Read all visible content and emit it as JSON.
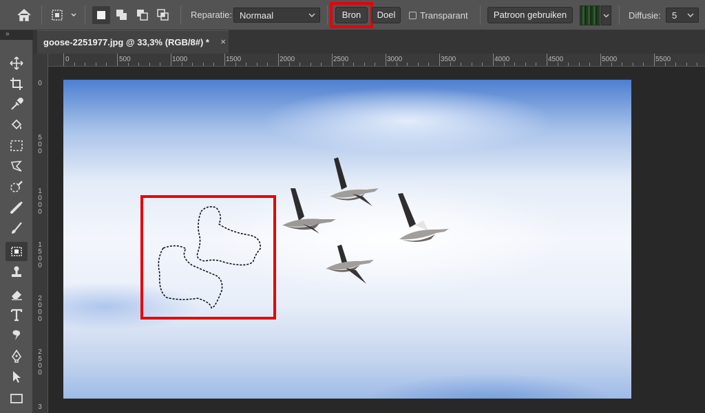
{
  "options_bar": {
    "icons": [
      "home-icon",
      "patch-tool-preset-icon",
      "selection-mode-new-icon",
      "selection-mode-add-icon",
      "selection-mode-subtract-icon",
      "selection-mode-intersect-icon"
    ],
    "repair_label": "Reparatie:",
    "repair_value": "Normaal",
    "source_label": "Bron",
    "destination_label": "Doel",
    "transparent_label": "Transparant",
    "transparent_checked": false,
    "use_pattern_label": "Patroon gebruiken",
    "diffusion_label": "Diffusie:",
    "diffusion_value": "5",
    "highlight_color": "#e8000a"
  },
  "document": {
    "collapse_label": "»",
    "tab_title": "goose-2251977.jpg @ 33,3% (RGB/8#) *",
    "close_label": "×"
  },
  "rulers": {
    "horizontal": [
      "0",
      "500",
      "1000",
      "1500",
      "2000",
      "2500",
      "3000",
      "3500",
      "4000",
      "4500",
      "5000",
      "5500"
    ],
    "vertical": [
      "0",
      "500",
      "1000",
      "1500",
      "2000",
      "2500",
      "3"
    ]
  },
  "tools": [
    "move-tool-icon",
    "crop-tool-icon",
    "eyedropper-tool-icon",
    "paint-bucket-tool-icon",
    "marquee-tool-icon",
    "lasso-tool-icon",
    "quick-selection-tool-icon",
    "healing-brush-tool-icon",
    "brush-tool-icon",
    "patch-tool-icon",
    "clone-stamp-tool-icon",
    "eraser-tool-icon",
    "type-tool-icon",
    "smudge-tool-icon",
    "pen-tool-icon",
    "path-selection-tool-icon",
    "rectangle-tool-icon"
  ],
  "active_tool": "patch-tool-icon",
  "canvas": {
    "image_subject": "geese-in-sky",
    "selection_highlight_color": "#e8000a"
  }
}
